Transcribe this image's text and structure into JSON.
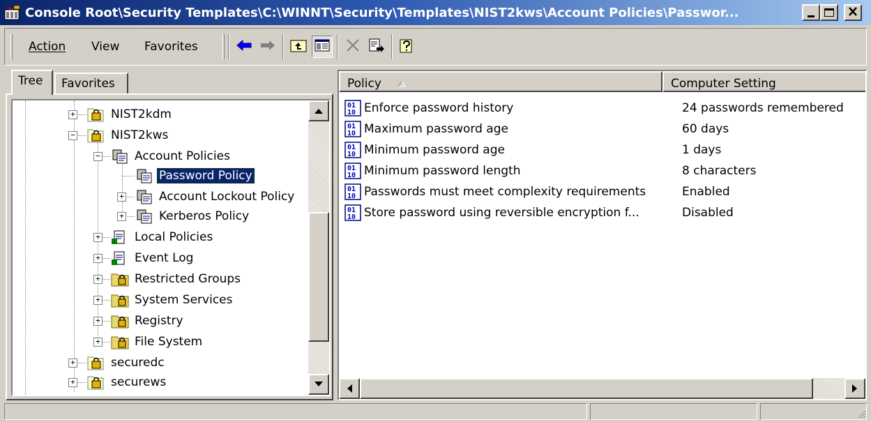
{
  "window": {
    "title": "Console Root\\Security Templates\\C:\\WINNT\\Security\\Templates\\NIST2kws\\Account Policies\\Passwor...",
    "minimize": "_",
    "maximize": "□",
    "close": "×"
  },
  "menu": {
    "action": "Action",
    "view": "View",
    "favorites": "Favorites"
  },
  "tabs": {
    "tree": "Tree",
    "favorites": "Favorites"
  },
  "tree": {
    "items": [
      {
        "label": "NIST2kdm"
      },
      {
        "label": "NIST2kws"
      },
      {
        "label": "Account Policies"
      },
      {
        "label": "Password Policy"
      },
      {
        "label": "Account Lockout Policy"
      },
      {
        "label": "Kerberos Policy"
      },
      {
        "label": "Local Policies"
      },
      {
        "label": "Event Log"
      },
      {
        "label": "Restricted Groups"
      },
      {
        "label": "System Services"
      },
      {
        "label": "Registry"
      },
      {
        "label": "File System"
      },
      {
        "label": "securedc"
      },
      {
        "label": "securews"
      }
    ]
  },
  "list": {
    "columns": {
      "policy": "Policy",
      "setting": "Computer Setting"
    },
    "rows": [
      {
        "policy": "Enforce password history",
        "setting": "24 passwords remembered"
      },
      {
        "policy": "Maximum password age",
        "setting": "60 days"
      },
      {
        "policy": "Minimum password age",
        "setting": "1 days"
      },
      {
        "policy": "Minimum password length",
        "setting": "8 characters"
      },
      {
        "policy": "Passwords must meet complexity requirements",
        "setting": "Enabled"
      },
      {
        "policy": "Store password using reversible encryption f...",
        "setting": "Disabled"
      }
    ]
  },
  "colors": {
    "titlebar": "#0a246a",
    "selection": "#0a246a",
    "chrome": "#d4d0c8"
  }
}
